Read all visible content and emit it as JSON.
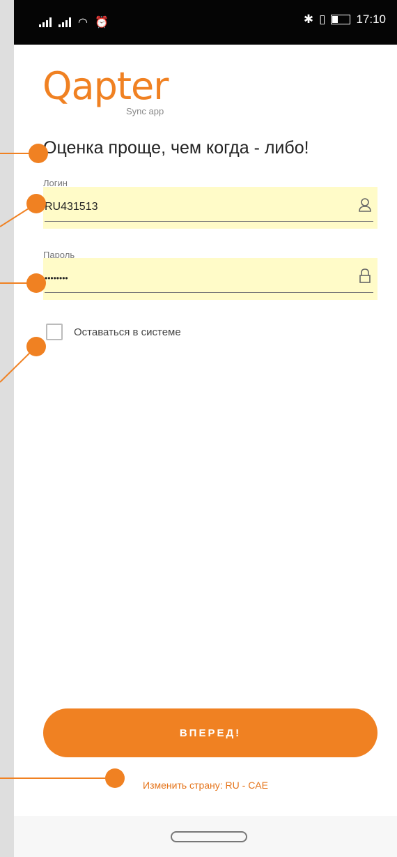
{
  "status_bar": {
    "time": "17:10"
  },
  "logo": {
    "wordmark": "Qapter",
    "subtitle": "Sync app"
  },
  "headline": "Оценка проще, чем когда - либо!",
  "login": {
    "label": "Логин",
    "value": "RU431513",
    "icon": "user-icon"
  },
  "password": {
    "label": "Пароль",
    "value": "••••••••",
    "icon": "lock-icon"
  },
  "remember_me": {
    "label": "Оставаться в системе",
    "checked": false
  },
  "submit_button": {
    "label": "ВПЕРЕД!"
  },
  "change_country": {
    "label": "Изменить страну: RU - CAE"
  },
  "colors": {
    "accent": "#f08122",
    "autofill": "#fffbc8",
    "annotation": "#f08122"
  }
}
